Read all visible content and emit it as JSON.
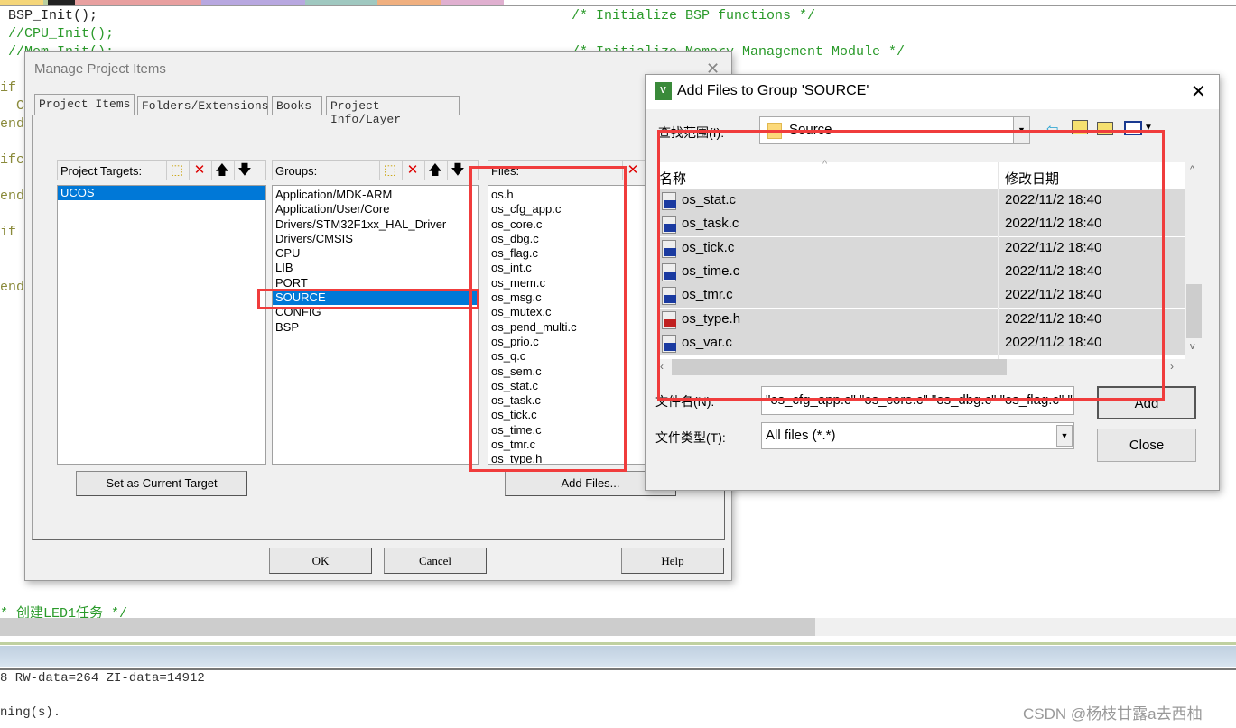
{
  "editor": {
    "tab_colors": [
      "#f5d67a",
      "#b9cfa0",
      "#222222",
      "#e8a0a0",
      "#e8a0a0",
      "#b8a8e0",
      "#a0c8c0",
      "#f0b080",
      "#e0b0d0"
    ],
    "code_lines": [
      {
        "code": " BSP_Init();",
        "comment": "/* Initialize BSP functions */"
      },
      {
        "code": " //CPU_Init();",
        "comment": ""
      },
      {
        "code": " //Mem_Init();",
        "comment": "/* Initialize Memory Management Module */"
      }
    ],
    "left_fragments": [
      "if",
      "  C",
      "end",
      "ifc",
      "end",
      "if",
      "end"
    ],
    "bottom_comment": "* 创建LED1任务 */",
    "output_lines": [
      "8 RW-data=264 ZI-data=14912",
      "ning(s)."
    ],
    "watermark": "CSDN @杨枝甘露a去西柚"
  },
  "manage": {
    "title": "Manage Project Items",
    "tabs": [
      "Project Items",
      "Folders/Extensions",
      "Books",
      "Project Info/Layer"
    ],
    "targets_label": "Project Targets:",
    "targets": [
      "UCOS"
    ],
    "groups_label": "Groups:",
    "groups": [
      "Application/MDK-ARM",
      "Application/User/Core",
      "Drivers/STM32F1xx_HAL_Driver",
      "Drivers/CMSIS",
      "CPU",
      "LIB",
      "PORT",
      "SOURCE",
      "CONFIG",
      "BSP"
    ],
    "selected_group": "SOURCE",
    "files_label": "Files:",
    "files": [
      "os.h",
      "os_cfg_app.c",
      "os_core.c",
      "os_dbg.c",
      "os_flag.c",
      "os_int.c",
      "os_mem.c",
      "os_msg.c",
      "os_mutex.c",
      "os_pend_multi.c",
      "os_prio.c",
      "os_q.c",
      "os_sem.c",
      "os_stat.c",
      "os_task.c",
      "os_tick.c",
      "os_time.c",
      "os_tmr.c",
      "os_type.h"
    ],
    "set_target": "Set as Current Target",
    "add_files": "Add Files...",
    "ok": "OK",
    "cancel": "Cancel",
    "help": "Help"
  },
  "addfiles": {
    "title": "Add Files to Group 'SOURCE'",
    "look_in_label": "查找范围(I):",
    "look_in": "Source",
    "col_name": "名称",
    "col_date": "修改日期",
    "rows": [
      {
        "name": "os_stat.c",
        "date": "2022/11/2 18:40",
        "type": "c"
      },
      {
        "name": "os_task.c",
        "date": "2022/11/2 18:40",
        "type": "c"
      },
      {
        "name": "os_tick.c",
        "date": "2022/11/2 18:40",
        "type": "c"
      },
      {
        "name": "os_time.c",
        "date": "2022/11/2 18:40",
        "type": "c"
      },
      {
        "name": "os_tmr.c",
        "date": "2022/11/2 18:40",
        "type": "c"
      },
      {
        "name": "os_type.h",
        "date": "2022/11/2 18:40",
        "type": "h"
      },
      {
        "name": "os_var.c",
        "date": "2022/11/2 18:40",
        "type": "c"
      }
    ],
    "filename_label": "文件名(N):",
    "filename": "\"os_cfg_app.c\" \"os_core.c\" \"os_dbg.c\" \"os_flag.c\" \"c",
    "filetype_label": "文件类型(T):",
    "filetype": "All files (*.*)",
    "add": "Add",
    "close": "Close"
  },
  "colors": {
    "highlight": "#f03c3c",
    "selection": "#0078d7"
  }
}
